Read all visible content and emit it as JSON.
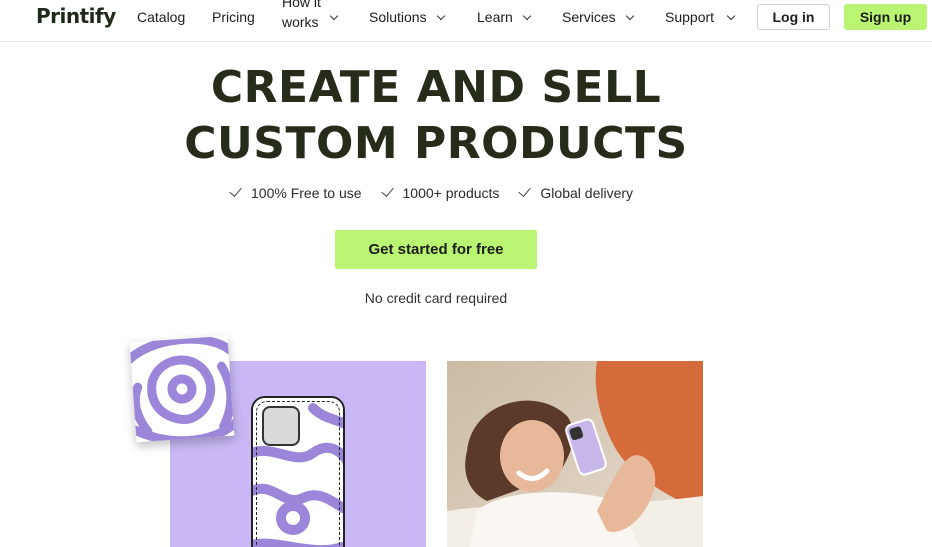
{
  "brand": {
    "logo_text": "Printify"
  },
  "nav": {
    "catalog": "Catalog",
    "pricing": "Pricing",
    "how_it_works": "How it works",
    "solutions": "Solutions",
    "learn": "Learn",
    "services": "Services",
    "support": "Support",
    "login": "Log in",
    "signup": "Sign up"
  },
  "hero": {
    "title_line1": "CREATE AND SELL",
    "title_line2": "CUSTOM PRODUCTS",
    "features": [
      "100% Free to use",
      "1000+ products",
      "Global delivery"
    ],
    "cta_label": "Get started for free",
    "note": "No credit card required"
  },
  "colors": {
    "accent_green": "#b9f572",
    "lilac": "#c9b8f5",
    "swirl_purple": "#9c86d9"
  },
  "icons": {
    "nav_dropdown": "chevron-down-icon",
    "feature": "check-icon"
  }
}
